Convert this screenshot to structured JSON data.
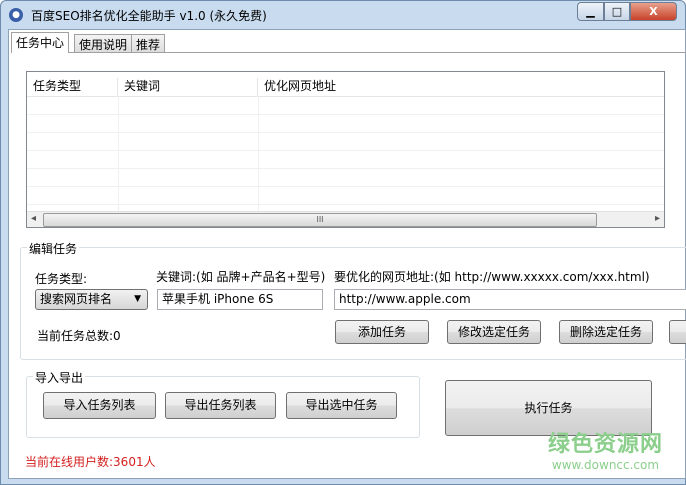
{
  "window": {
    "title": "百度SEO排名优化全能助手 v1.0 (永久免费)",
    "minimize": "▁",
    "maximize": "□",
    "close": "X"
  },
  "tabs": [
    {
      "label": "任务中心"
    },
    {
      "label": "使用说明"
    },
    {
      "label": "推荐"
    }
  ],
  "list": {
    "columns": [
      "任务类型",
      "关键词",
      "优化网页地址"
    ],
    "scroll_thumb": "III",
    "scroll_left": "◂",
    "scroll_right": "▸"
  },
  "edit": {
    "group_label": "编辑任务",
    "type_label": "任务类型:",
    "type_value": "搜索网页排名",
    "keyword_label": "关键词:(如 品牌+产品名+型号)",
    "keyword_value": "苹果手机 iPhone 6S",
    "url_label": "要优化的网页地址:(如 http://www.xxxxx.com/xxx.html)",
    "url_value": "http://www.apple.com",
    "total_label": "当前任务总数:0",
    "add": "添加任务",
    "modify": "修改选定任务",
    "delete": "删除选定任务"
  },
  "io": {
    "group_label": "导入导出",
    "import": "导入任务列表",
    "export": "导出任务列表",
    "export_selected": "导出选中任务"
  },
  "execute": "执行任务",
  "status": "当前在线用户数:3601人",
  "watermark": {
    "name": "绿色资源网",
    "url": "www.downcc.com"
  }
}
